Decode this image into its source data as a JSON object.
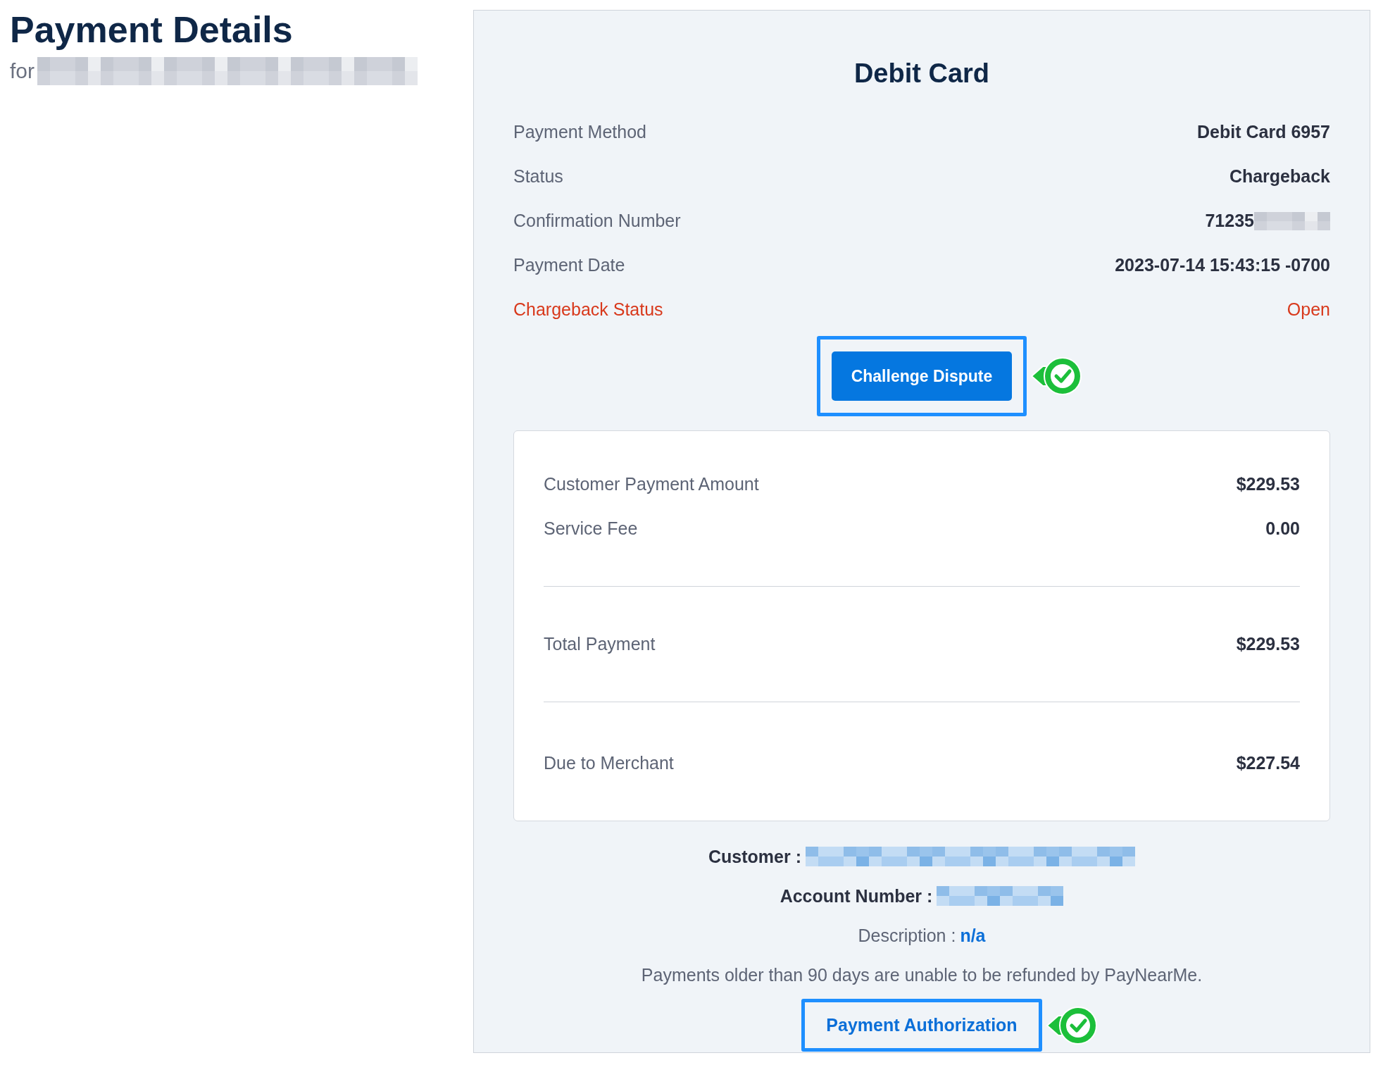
{
  "page": {
    "title": "Payment Details",
    "subtitle_prefix": "for",
    "subtitle_redacted": true
  },
  "card": {
    "title": "Debit Card",
    "rows": [
      {
        "label": "Payment Method",
        "value": "Debit Card 6957",
        "value_redacted": false,
        "alert": false
      },
      {
        "label": "Status",
        "value": "Chargeback",
        "value_redacted": false,
        "alert": false
      },
      {
        "label": "Confirmation Number",
        "value": "71235",
        "value_redacted": true,
        "alert": false
      },
      {
        "label": "Payment Date",
        "value": "2023-07-14 15:43:15 -0700",
        "value_redacted": false,
        "alert": false
      },
      {
        "label": "Chargeback Status",
        "value": "Open",
        "value_redacted": false,
        "alert": true
      }
    ],
    "primary_button": {
      "label": "Challenge Dispute",
      "highlighted": true,
      "checked": true
    },
    "summary": {
      "groups": [
        [
          {
            "label": "Customer Payment Amount",
            "value": "$229.53"
          },
          {
            "label": "Service Fee",
            "value": "0.00"
          }
        ],
        [
          {
            "label": "Total Payment",
            "value": "$229.53"
          }
        ],
        [
          {
            "label": "Due to Merchant",
            "value": "$227.54"
          }
        ]
      ]
    },
    "customer": {
      "label": "Customer :",
      "redacted": true
    },
    "account": {
      "label": "Account Number :",
      "redacted": true
    },
    "description": {
      "label": "Description :",
      "value": "n/a"
    },
    "notice": "Payments older than 90 days are unable to be refunded by PayNearMe.",
    "link_button": {
      "label": "Payment Authorization",
      "highlighted": true,
      "checked": true
    }
  }
}
